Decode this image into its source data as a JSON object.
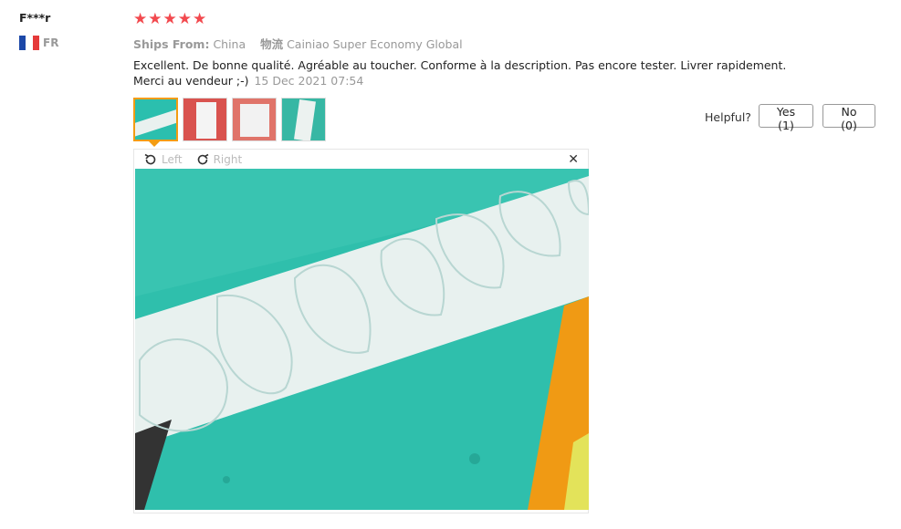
{
  "reviewer": {
    "name": "F***r",
    "country_code": "FR",
    "flag_colors": [
      "#1c48a8",
      "#ffffff",
      "#e53a3a"
    ]
  },
  "rating": {
    "stars": 5,
    "star_glyph": "★",
    "color": "#f2494e"
  },
  "shipping": {
    "ships_from_label": "Ships From:",
    "ships_from_value": "China",
    "logistics_label": "物流",
    "logistics_value": "Cainiao Super Economy Global"
  },
  "review": {
    "text": "Excellent. De bonne qualité. Agréable au toucher. Conforme à la description. Pas encore tester. Livrer rapidement. Merci au vendeur ;-)",
    "date": "15 Dec 2021 07:54"
  },
  "photos": {
    "count": 4,
    "active_index": 0
  },
  "feedback": {
    "helpful_label": "Helpful?",
    "yes_label": "Yes (1)",
    "no_label": "No (0)"
  },
  "viewer": {
    "rotate_left_label": "Left",
    "rotate_right_label": "Right",
    "close_glyph": "✕"
  }
}
